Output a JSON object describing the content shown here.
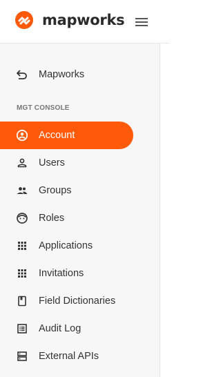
{
  "brand": {
    "name": "mapworks",
    "accent_color": "#ff5a0a",
    "logo_icon": "mapworks-logo-icon"
  },
  "header": {
    "menu_icon": "hamburger-menu-icon"
  },
  "sidebar": {
    "back_item": {
      "label": "Mapworks",
      "icon": "back-arrow-icon"
    },
    "section_label": "MGT CONSOLE",
    "items": [
      {
        "label": "Account",
        "icon": "account-circle-icon",
        "active": true
      },
      {
        "label": "Users",
        "icon": "user-icon",
        "active": false
      },
      {
        "label": "Groups",
        "icon": "groups-icon",
        "active": false
      },
      {
        "label": "Roles",
        "icon": "face-icon",
        "active": false
      },
      {
        "label": "Applications",
        "icon": "apps-grid-icon",
        "active": false
      },
      {
        "label": "Invitations",
        "icon": "apps-grid-icon",
        "active": false
      },
      {
        "label": "Field Dictionaries",
        "icon": "book-icon",
        "active": false
      },
      {
        "label": "Audit Log",
        "icon": "list-icon",
        "active": false
      },
      {
        "label": "External APIs",
        "icon": "storage-icon",
        "active": false
      }
    ]
  }
}
